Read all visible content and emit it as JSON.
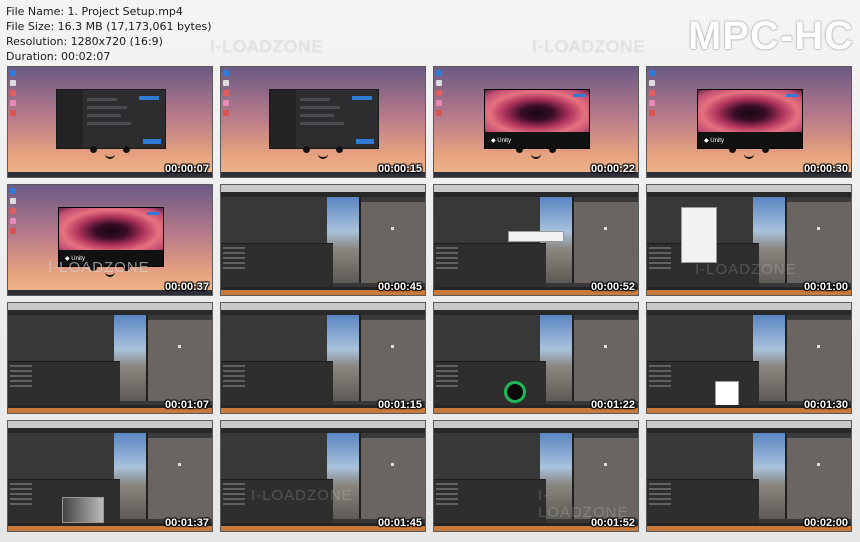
{
  "header": {
    "file_name": "File Name: 1. Project Setup.mp4",
    "file_size": "File Size: 16.3 MB (17,173,061 bytes)",
    "resolution": "Resolution: 1280x720 (16:9)",
    "duration": "Duration: 00:02:07"
  },
  "logo": "MPC-HC",
  "watermark": "I-LOADZONE",
  "thumbnails": [
    {
      "time": "00:00:07",
      "kind": "desktop-dialog"
    },
    {
      "time": "00:00:15",
      "kind": "desktop-dialog"
    },
    {
      "time": "00:00:22",
      "kind": "desktop-splash"
    },
    {
      "time": "00:00:30",
      "kind": "desktop-splash"
    },
    {
      "time": "00:00:37",
      "kind": "desktop-splash"
    },
    {
      "time": "00:00:45",
      "kind": "editor"
    },
    {
      "time": "00:00:52",
      "kind": "editor"
    },
    {
      "time": "00:01:00",
      "kind": "editor"
    },
    {
      "time": "00:01:07",
      "kind": "editor"
    },
    {
      "time": "00:01:15",
      "kind": "editor"
    },
    {
      "time": "00:01:22",
      "kind": "editor"
    },
    {
      "time": "00:01:30",
      "kind": "editor"
    },
    {
      "time": "00:01:37",
      "kind": "editor"
    },
    {
      "time": "00:01:45",
      "kind": "editor"
    },
    {
      "time": "00:01:52",
      "kind": "editor"
    },
    {
      "time": "00:02:00",
      "kind": "editor"
    }
  ],
  "colors": {
    "accent_blue": "#2f7bd6",
    "taskbar_orange": "#c8793c",
    "unity_dark": "#383838"
  }
}
